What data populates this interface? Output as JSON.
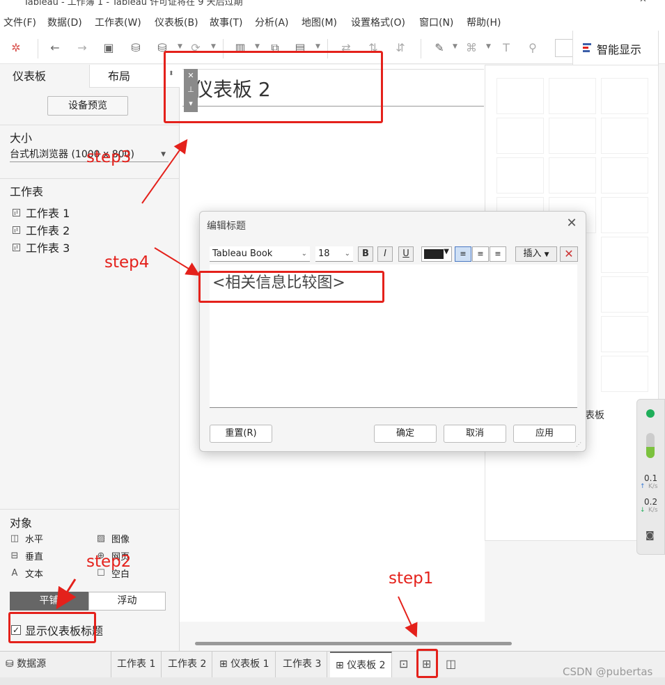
{
  "window": {
    "title": "Tableau - 工作簿 1 - Tableau 许可证将在 9 天后过期",
    "min": "—",
    "close": "✕"
  },
  "menu": [
    "文件(F)",
    "数据(D)",
    "工作表(W)",
    "仪表板(B)",
    "故事(T)",
    "分析(A)",
    "地图(M)",
    "设置格式(O)",
    "窗口(N)",
    "帮助(H)"
  ],
  "smart_display": {
    "label": "智能显示"
  },
  "left_panel": {
    "tab_dashboard": "仪表板",
    "tab_layout": "布局",
    "device_preview": "设备预览",
    "size_heading": "大小",
    "size_value": "台式机浏览器 (1000 x 800)",
    "sheets_heading": "工作表",
    "sheets": [
      "工作表 1",
      "工作表 2",
      "工作表 3"
    ],
    "objects_heading": "对象",
    "objects": [
      "水平",
      "图像",
      "垂直",
      "网页",
      "文本",
      "空白"
    ],
    "tile": "平铺",
    "float": "浮动",
    "show_title_label": "显示仪表板标题"
  },
  "canvas": {
    "dashboard_title": "仪表板 2"
  },
  "viz_hint": "表板",
  "net_widget": {
    "up": "0.1",
    "up_unit": "K/s",
    "down": "0.2",
    "down_unit": "K/s"
  },
  "dialog": {
    "title": "编辑标题",
    "font": "Tableau Book",
    "size": "18",
    "bold": "B",
    "italic": "I",
    "underline": "U",
    "insert": "插入",
    "text": "<相关信息比较图>",
    "reset": "重置(R)",
    "ok": "确定",
    "cancel": "取消",
    "apply": "应用"
  },
  "sheet_tabs": {
    "datasource": "数据源",
    "tabs": [
      "工作表 1",
      "工作表 2",
      "仪表板 1",
      "工作表 3",
      "仪表板 2"
    ]
  },
  "annotations": {
    "step1": "step1",
    "step2": "step2",
    "step3": "step3",
    "step4": "step4"
  },
  "watermark": "CSDN @pubertas",
  "colors": {
    "annotation": "#e4211b",
    "tile_active": "#666666",
    "color_swatch": "#222222"
  }
}
